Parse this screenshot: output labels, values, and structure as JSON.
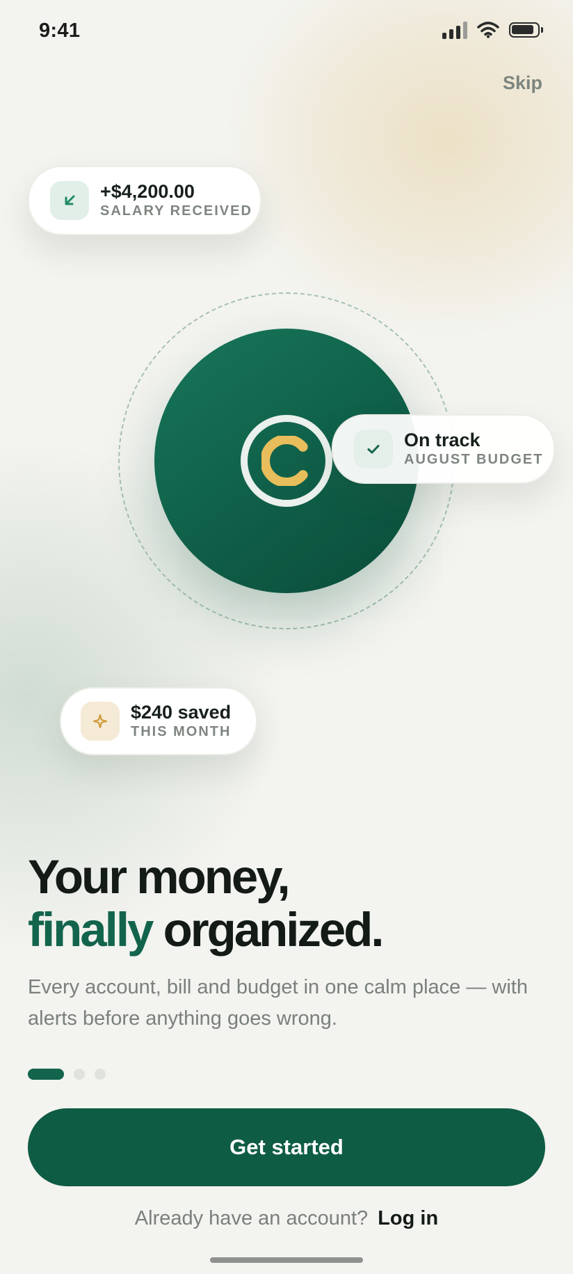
{
  "status_bar": {
    "time": "9:41"
  },
  "header": {
    "skip_label": "Skip"
  },
  "cards": {
    "salary": {
      "amount": "+$4,200.00",
      "label": "SALARY RECEIVED",
      "icon": "arrow-down-left-icon"
    },
    "budget": {
      "status": "On track",
      "label": "AUGUST BUDGET",
      "icon": "check-icon"
    },
    "savings": {
      "amount": "$240 saved",
      "label": "THIS MONTH",
      "icon": "sparkle-icon"
    }
  },
  "hero": {
    "title_line1": "Your money,",
    "title_accent": "finally",
    "title_rest": "organized.",
    "subtitle": "Every account, bill and budget in one calm place — with alerts before anything goes wrong."
  },
  "pager": {
    "total": 3,
    "active": 0
  },
  "cta": {
    "label": "Get started"
  },
  "login": {
    "prompt": "Already have an account?",
    "link": "Log in"
  },
  "colors": {
    "brand_green": "#0f5c45",
    "accent_gold": "#e8bd5c",
    "background": "#f3f3ef"
  }
}
